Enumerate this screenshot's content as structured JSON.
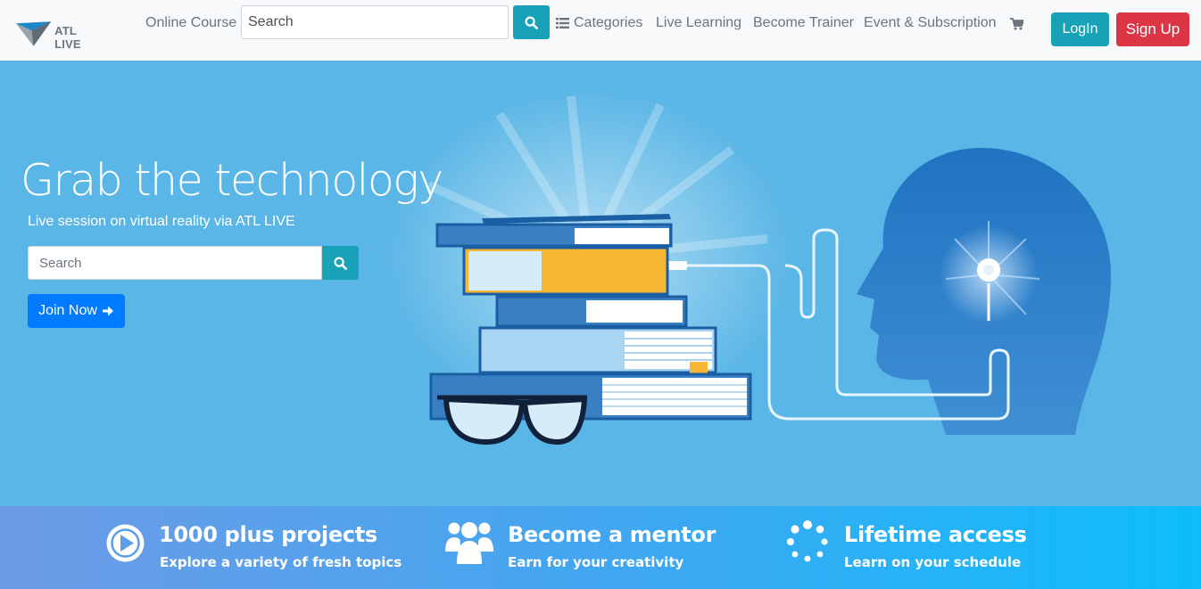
{
  "brand": {
    "name": "ATL LIVE"
  },
  "nav": {
    "online_course": "Online Course",
    "search_placeholder": "Search",
    "categories": "Categories",
    "live_learning": "Live Learning",
    "become_trainer": "Become Trainer",
    "event_subscription": "Event & Subscription",
    "login": "LogIn",
    "signup": "Sign Up"
  },
  "hero": {
    "title": "Grab the technology",
    "subtitle": "Live session on virtual reality via ATL LIVE",
    "search_placeholder": "Search",
    "join_button": "Join Now"
  },
  "features": [
    {
      "icon": "play-circle-icon",
      "title": "1000 plus projects",
      "subtitle": "Explore a variety of fresh topics"
    },
    {
      "icon": "users-icon",
      "title": "Become a mentor",
      "subtitle": "Earn for your creativity"
    },
    {
      "icon": "spinner-icon",
      "title": "Lifetime access",
      "subtitle": "Learn on your schedule"
    }
  ],
  "colors": {
    "primary": "#007bff",
    "info": "#17a2b8",
    "danger": "#dc3545",
    "hero_bg": "#5ab6e6",
    "head": "#1f73c1"
  }
}
